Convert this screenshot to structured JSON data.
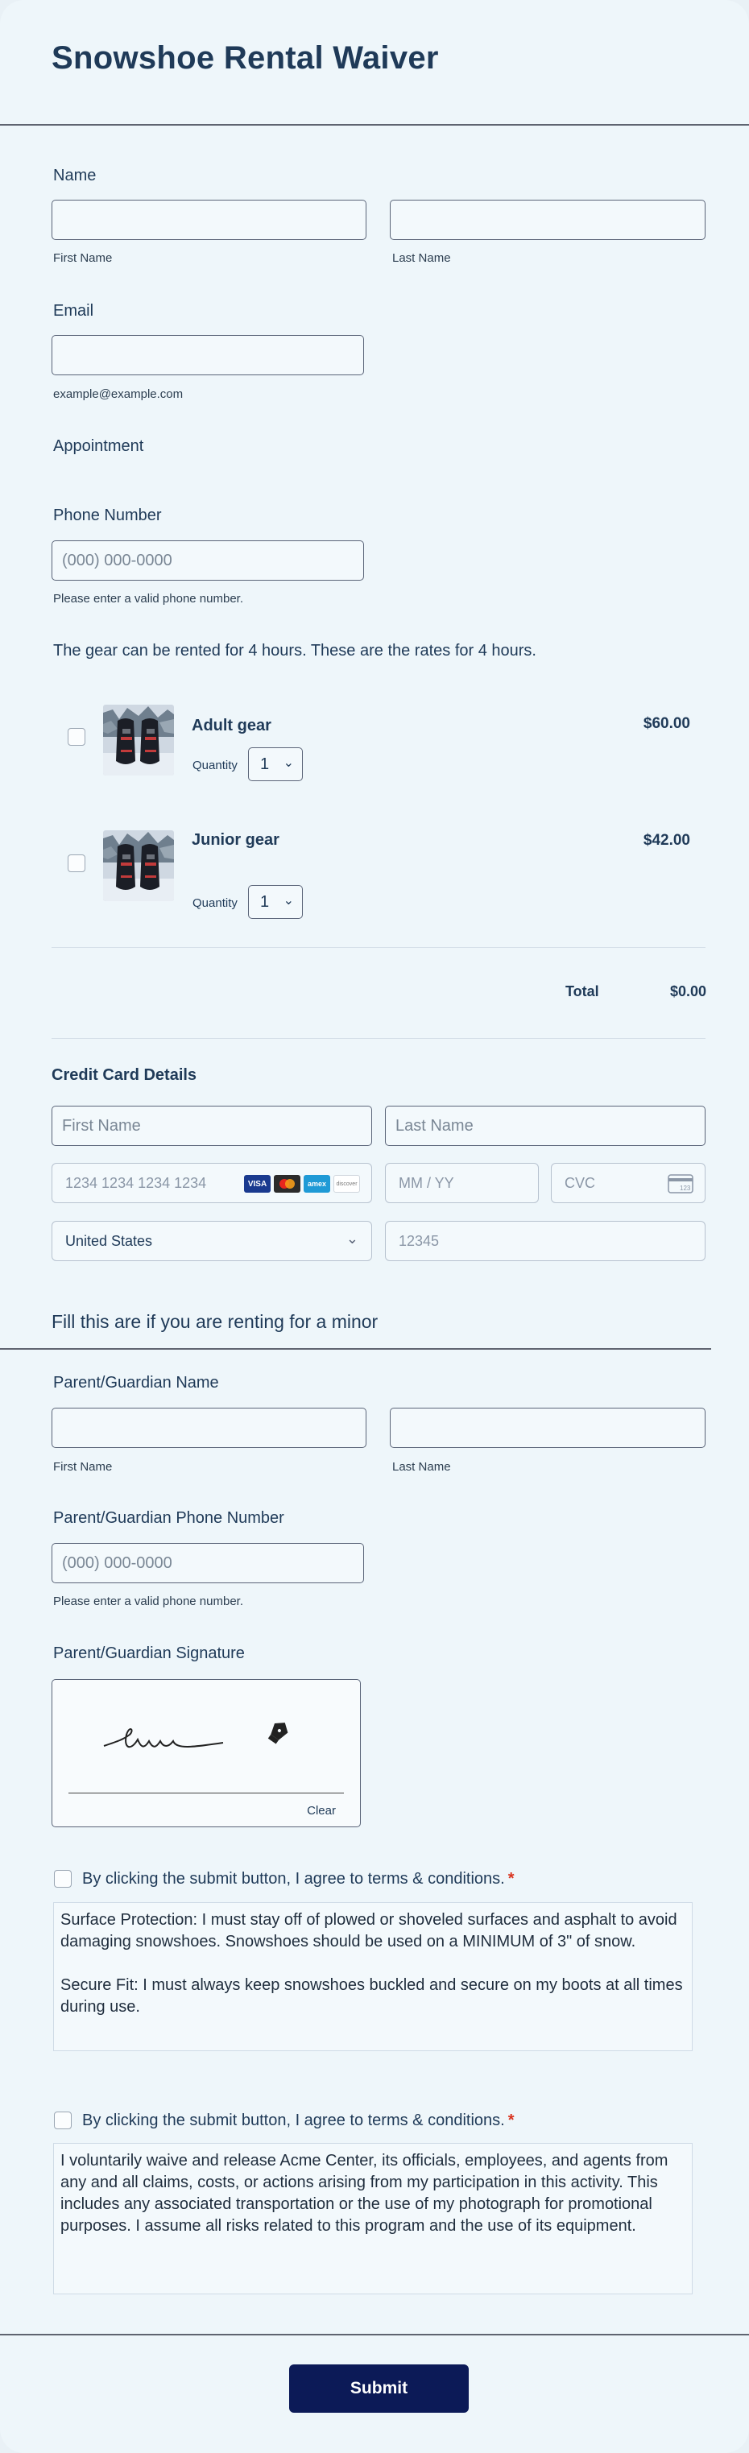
{
  "form": {
    "title": "Snowshoe Rental Waiver",
    "name": {
      "label": "Name",
      "first_sub": "First Name",
      "last_sub": "Last Name"
    },
    "email": {
      "label": "Email",
      "sub": "example@example.com"
    },
    "appointment": {
      "label": "Appointment"
    },
    "phone": {
      "label": "Phone Number",
      "placeholder": "(000) 000-0000",
      "sub": "Please enter a valid phone number."
    },
    "rates_text": "The gear can be rented for 4 hours. These are the rates for 4 hours.",
    "products": [
      {
        "name": "Adult gear",
        "price": "$60.00",
        "quantity_label": "Quantity",
        "quantity": "1",
        "image": "snowshoes-photo"
      },
      {
        "name": "Junior gear",
        "price": "$42.00",
        "quantity_label": "Quantity",
        "quantity": "1",
        "image": "snowshoes-photo"
      }
    ],
    "total": {
      "label": "Total",
      "value": "$0.00"
    },
    "card": {
      "heading": "Credit Card Details",
      "first_name_placeholder": "First Name",
      "last_name_placeholder": "Last Name",
      "number_placeholder": "1234 1234 1234 1234",
      "expiry_placeholder": "MM / YY",
      "cvc_placeholder": "CVC",
      "country": "United States",
      "zip_placeholder": "12345",
      "brands": [
        "VISA",
        "mastercard",
        "amex",
        "discover"
      ]
    },
    "minor_section": {
      "heading": "Fill this are if you are renting for a minor"
    },
    "guardian_name": {
      "label": "Parent/Guardian Name",
      "first_sub": "First Name",
      "last_sub": "Last Name"
    },
    "guardian_phone": {
      "label": "Parent/Guardian Phone Number",
      "placeholder": "(000) 000-0000",
      "sub": "Please enter a valid phone number."
    },
    "guardian_signature": {
      "label": "Parent/Guardian Signature",
      "clear": "Clear"
    },
    "terms": [
      {
        "agree": "By clicking the submit button, I agree to terms & conditions.",
        "required_mark": "*",
        "text": "Surface Protection: I must stay off of plowed or shoveled surfaces and asphalt to avoid damaging snowshoes. Snowshoes should be used on a MINIMUM of 3\" of snow.\n\nSecure Fit: I must always keep snowshoes buckled and secure on my boots at all times during use."
      },
      {
        "agree": "By clicking the submit button, I agree to terms & conditions.",
        "required_mark": "*",
        "text": "I voluntarily waive and release Acme Center, its officials, employees, and agents from any and all claims, costs, or actions arising from my participation in this activity. This includes any associated transportation or the use of my photograph for promotional purposes. I assume all risks related to this program and the use of its equipment."
      }
    ],
    "submit_label": "Submit"
  },
  "colors": {
    "accent": "#0c1a57",
    "text": "#1f3a58",
    "required": "#d9341f",
    "background": "#eef6fa"
  }
}
